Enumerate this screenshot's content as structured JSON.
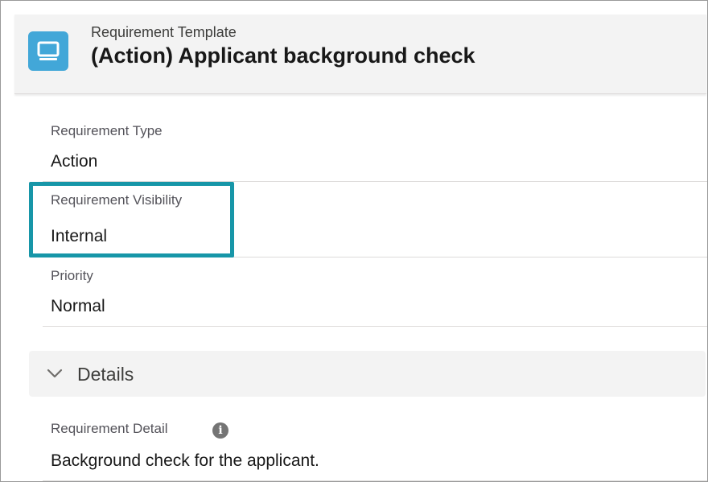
{
  "header": {
    "object_icon": "computer-monitor-icon",
    "object_type": "Requirement Template",
    "title": "(Action) Applicant background check"
  },
  "fields": {
    "requirement_type": {
      "label": "Requirement Type",
      "value": "Action"
    },
    "requirement_visibility": {
      "label": "Requirement Visibility",
      "value": "Internal"
    },
    "priority": {
      "label": "Priority",
      "value": "Normal"
    }
  },
  "details_section": {
    "title": "Details",
    "icon": "chevron-down-icon",
    "expanded": true,
    "requirement_detail": {
      "label": "Requirement Detail",
      "info_icon": "info-icon",
      "value": "Background check for the applicant."
    }
  },
  "colors": {
    "icon_background": "#42a7d8",
    "highlight_border": "#1796a8",
    "header_background": "#f3f3f3"
  }
}
